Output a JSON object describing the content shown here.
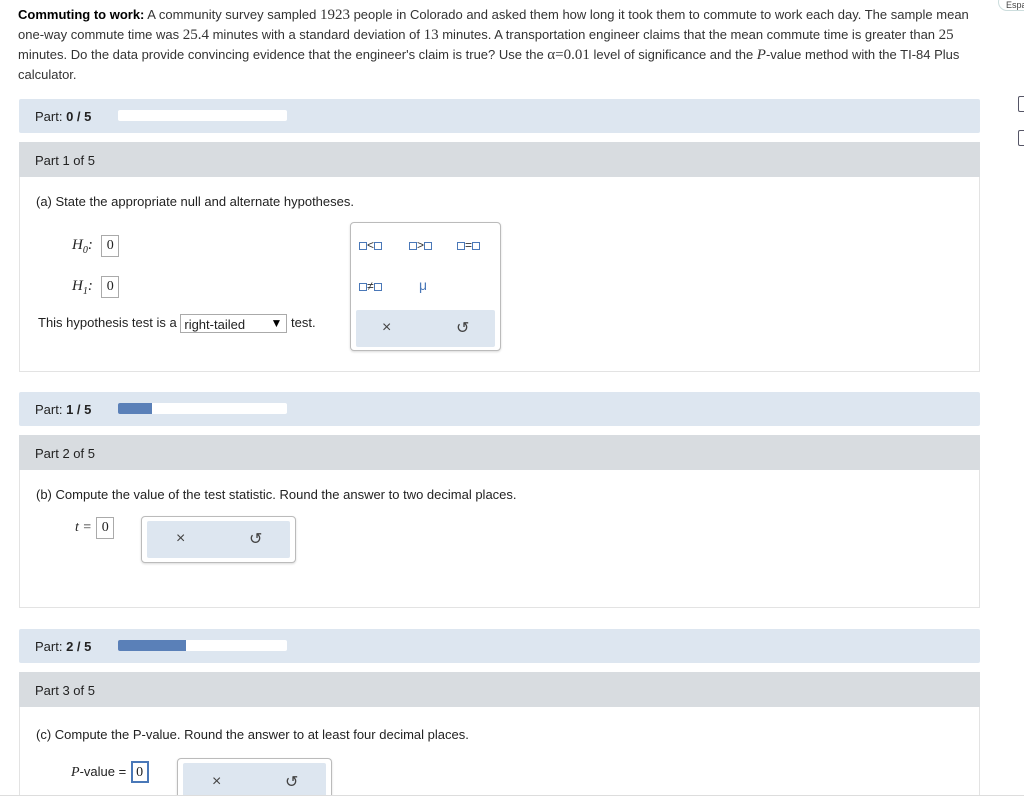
{
  "problem": {
    "title": "Commuting to work:",
    "text_1": " A community survey sampled ",
    "n": "1923",
    "text_2": " people in Colorado and asked them how long it took them to commute to work each day. The sample mean one-way commute time was ",
    "mean": "25.4",
    "text_3": " minutes with a standard deviation of ",
    "sd": "13",
    "text_4": " minutes. A transportation engineer claims that the mean commute time is greater than ",
    "claim": "25",
    "text_5": " minutes. Do the data provide convincing evidence that the engineer's claim is true? Use the ",
    "alpha": "α=0.01",
    "text_6": " level of significance and the ",
    "pvar": "P",
    "text_7": "-value method with the TI-84 Plus calculator."
  },
  "language_button": "Espa",
  "progress": [
    {
      "label": "Part:",
      "value": "0 / 5",
      "fraction": 0.0
    },
    {
      "label": "Part:",
      "value": "1 / 5",
      "fraction": 0.2
    },
    {
      "label": "Part:",
      "value": "2 / 5",
      "fraction": 0.4
    }
  ],
  "parts": [
    {
      "header": "Part 1 of 5",
      "question": "(a) State the appropriate null and alternate hypotheses."
    },
    {
      "header": "Part 2 of 5",
      "question": "(b) Compute the value of the test statistic. Round the answer to two decimal places."
    },
    {
      "header": "Part 3 of 5",
      "question": "(c) Compute the P-value. Round the answer to at least four decimal places."
    }
  ],
  "hypotheses": {
    "h0_label": "H",
    "h0_sub": "0",
    "h0_value": "0",
    "h1_label": "H",
    "h1_sub": "1",
    "h1_value": "0",
    "test_prefix": "This hypothesis test is a",
    "test_selected": "right-tailed",
    "test_suffix": "test."
  },
  "symbol_toolbar": {
    "lt": "<",
    "gt": ">",
    "eq": "=",
    "neq": "≠",
    "mu": "μ",
    "clear": "×",
    "undo": "↺"
  },
  "test_stat": {
    "label": "t =",
    "value": "0",
    "clear": "×",
    "undo": "↺"
  },
  "pvalue": {
    "label_var": "P",
    "label_rest": "-value =",
    "value": "0",
    "clear": "×",
    "undo": "↺"
  }
}
